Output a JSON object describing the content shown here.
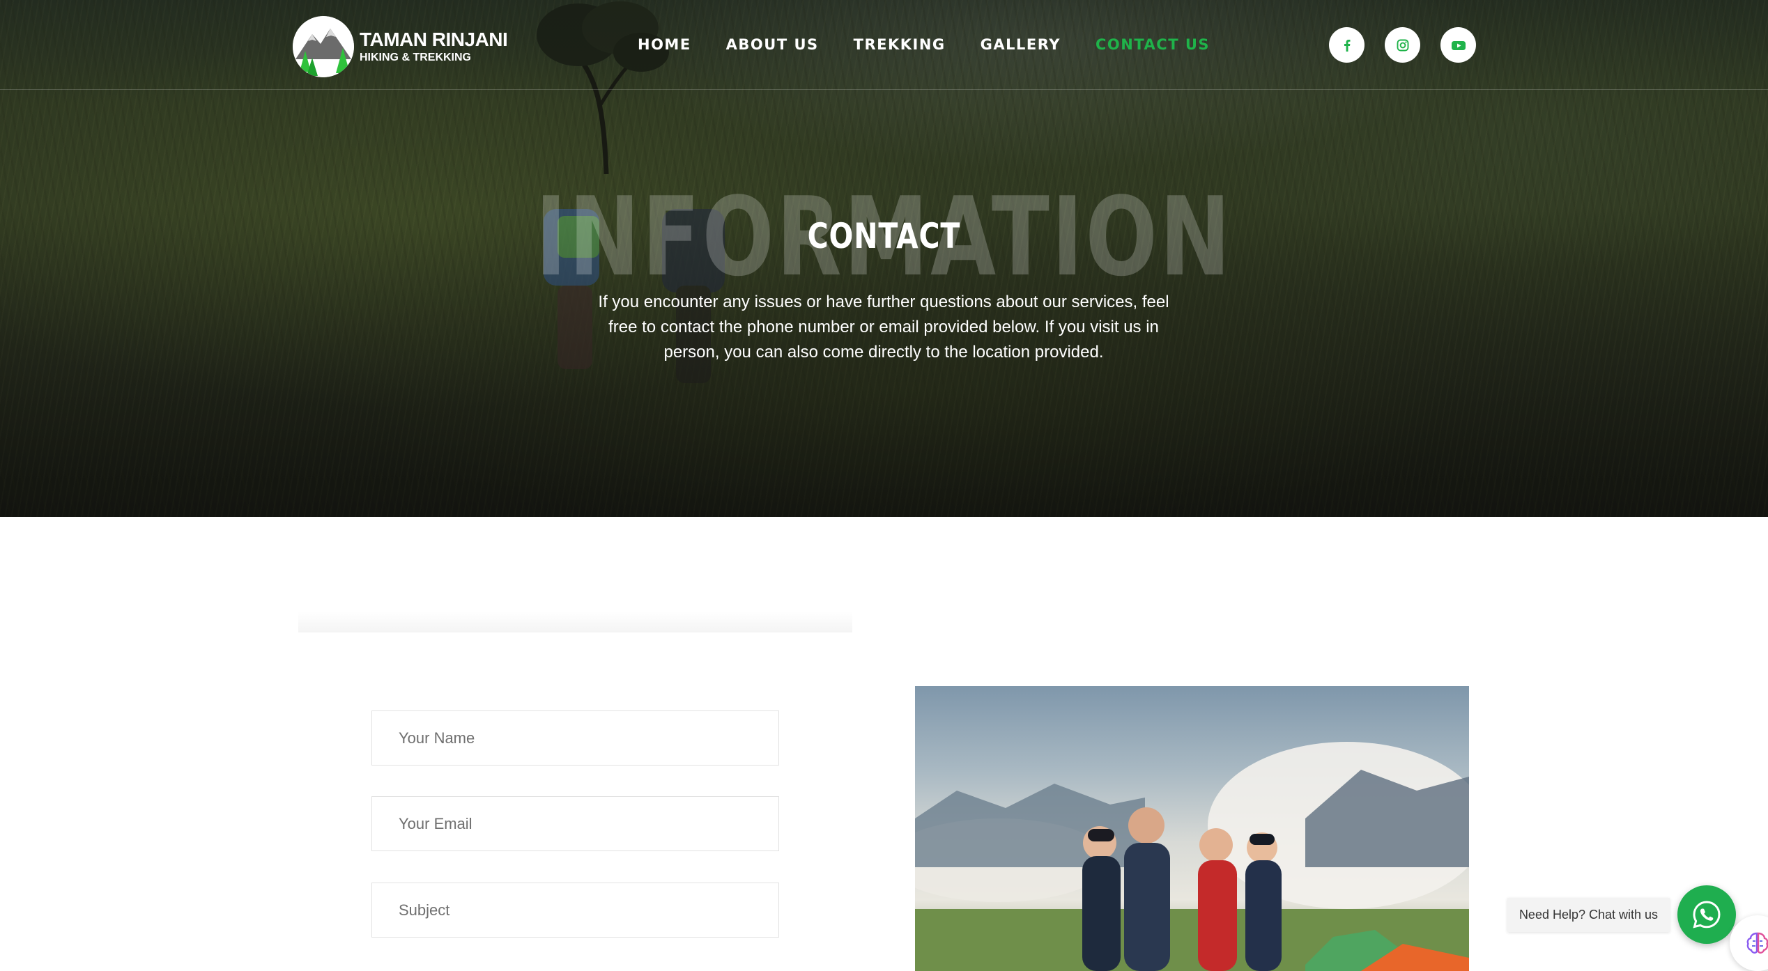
{
  "header": {
    "logo": {
      "title": "TAMAN RINJANI",
      "subtitle": "HIKING & TREKKING"
    },
    "nav": [
      {
        "label": "HOME",
        "active": false
      },
      {
        "label": "ABOUT US",
        "active": false
      },
      {
        "label": "TREKKING",
        "active": false
      },
      {
        "label": "GALLERY",
        "active": false
      },
      {
        "label": "CONTACT US",
        "active": true
      }
    ],
    "social": [
      {
        "icon": "facebook-icon"
      },
      {
        "icon": "instagram-icon"
      },
      {
        "icon": "youtube-icon"
      }
    ],
    "accent_color": "#1fb34a"
  },
  "hero": {
    "background_word": "INFORMATION",
    "title": "CONTACT",
    "description": "If you encounter any issues or have further questions about our services, feel free to contact the phone number or email provided below. If you visit us in person, you can also come directly to the location provided."
  },
  "form": {
    "name_placeholder": "Your Name",
    "email_placeholder": "Your Email",
    "subject_placeholder": "Subject"
  },
  "chat": {
    "prompt": "Need Help? Chat with us",
    "button_icon": "whatsapp-icon",
    "button_color": "#1fae4f",
    "ai_icon": "brain-icon"
  }
}
